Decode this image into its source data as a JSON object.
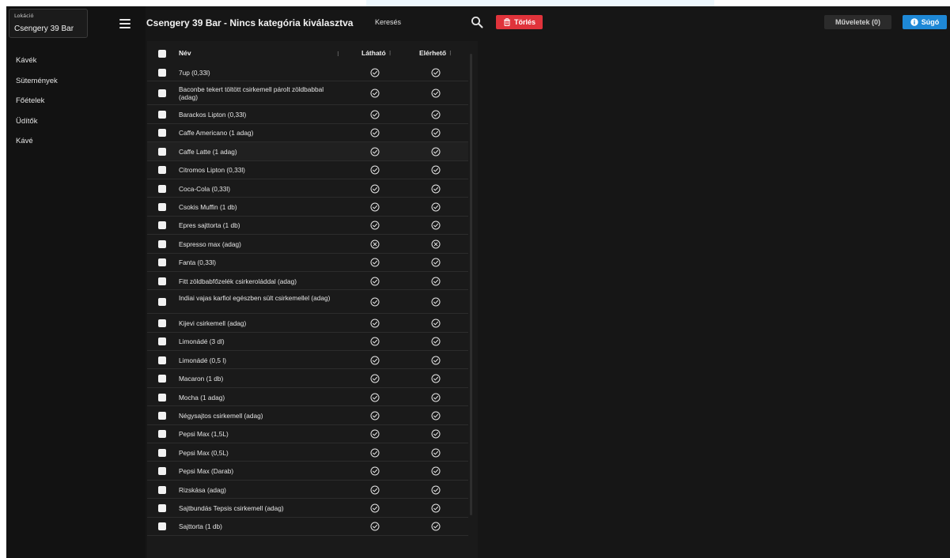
{
  "sidebar": {
    "location_label": "Lokáció",
    "location_value": "Csengery 39 Bar",
    "items": [
      {
        "label": "Kávék"
      },
      {
        "label": "Sütemények"
      },
      {
        "label": "Főételek"
      },
      {
        "label": "Üdítők"
      },
      {
        "label": "Kávé"
      }
    ]
  },
  "header": {
    "title": "Csengery 39 Bar - Nincs kategória kiválasztva",
    "search_placeholder": "Keresés",
    "delete_label": "Törlés",
    "operations_label": "Műveletek (0)",
    "help_label": "Súgó"
  },
  "table": {
    "columns": {
      "name": "Név",
      "visible": "Látható",
      "available": "Elérhető"
    },
    "rows": [
      {
        "name": "7up (0,33l)",
        "visible": true,
        "available": true
      },
      {
        "name": "Baconbe tekert töltött csirkemell párolt zöldbabbal (adag)",
        "visible": true,
        "available": true
      },
      {
        "name": "Barackos Lipton (0,33l)",
        "visible": true,
        "available": true
      },
      {
        "name": "Caffe Americano (1 adag)",
        "visible": true,
        "available": true
      },
      {
        "name": "Caffe Latte (1 adag)",
        "visible": true,
        "available": true
      },
      {
        "name": "Citromos Lipton (0,33l)",
        "visible": true,
        "available": true
      },
      {
        "name": "Coca-Cola (0,33l)",
        "visible": true,
        "available": true
      },
      {
        "name": "Csokis Muffin (1 db)",
        "visible": true,
        "available": true
      },
      {
        "name": "Epres sajttorta (1 db)",
        "visible": true,
        "available": true
      },
      {
        "name": "Espresso max (adag)",
        "visible": false,
        "available": false
      },
      {
        "name": "Fanta (0,33l)",
        "visible": true,
        "available": true
      },
      {
        "name": "Fitt zöldbabfőzelék csirkeroláddal (adag)",
        "visible": true,
        "available": true
      },
      {
        "name": "Indiai vajas karfiol egészben sült csirkemellel (adag)",
        "visible": true,
        "available": true
      },
      {
        "name": "Kijevi csirkemell (adag)",
        "visible": true,
        "available": true
      },
      {
        "name": "Limonádé (3 dl)",
        "visible": true,
        "available": true
      },
      {
        "name": "Limonádé (0,5 l)",
        "visible": true,
        "available": true
      },
      {
        "name": "Macaron (1 db)",
        "visible": true,
        "available": true
      },
      {
        "name": "Mocha (1 adag)",
        "visible": true,
        "available": true
      },
      {
        "name": "Négysajtos csirkemell (adag)",
        "visible": true,
        "available": true
      },
      {
        "name": "Pepsi Max (1,5L)",
        "visible": true,
        "available": true
      },
      {
        "name": "Pepsi Max (0,5L)",
        "visible": true,
        "available": true
      },
      {
        "name": "Pepsi Max (Darab)",
        "visible": true,
        "available": true
      },
      {
        "name": "Rizskása (adag)",
        "visible": true,
        "available": true
      },
      {
        "name": "Sajtbundás Tepsis csirkemell (adag)",
        "visible": true,
        "available": true
      },
      {
        "name": "Sajttorta (1 db)",
        "visible": true,
        "available": true
      }
    ]
  },
  "colors": {
    "accent_red": "#e0333b",
    "accent_blue": "#1e88d6",
    "background": "#161616"
  }
}
